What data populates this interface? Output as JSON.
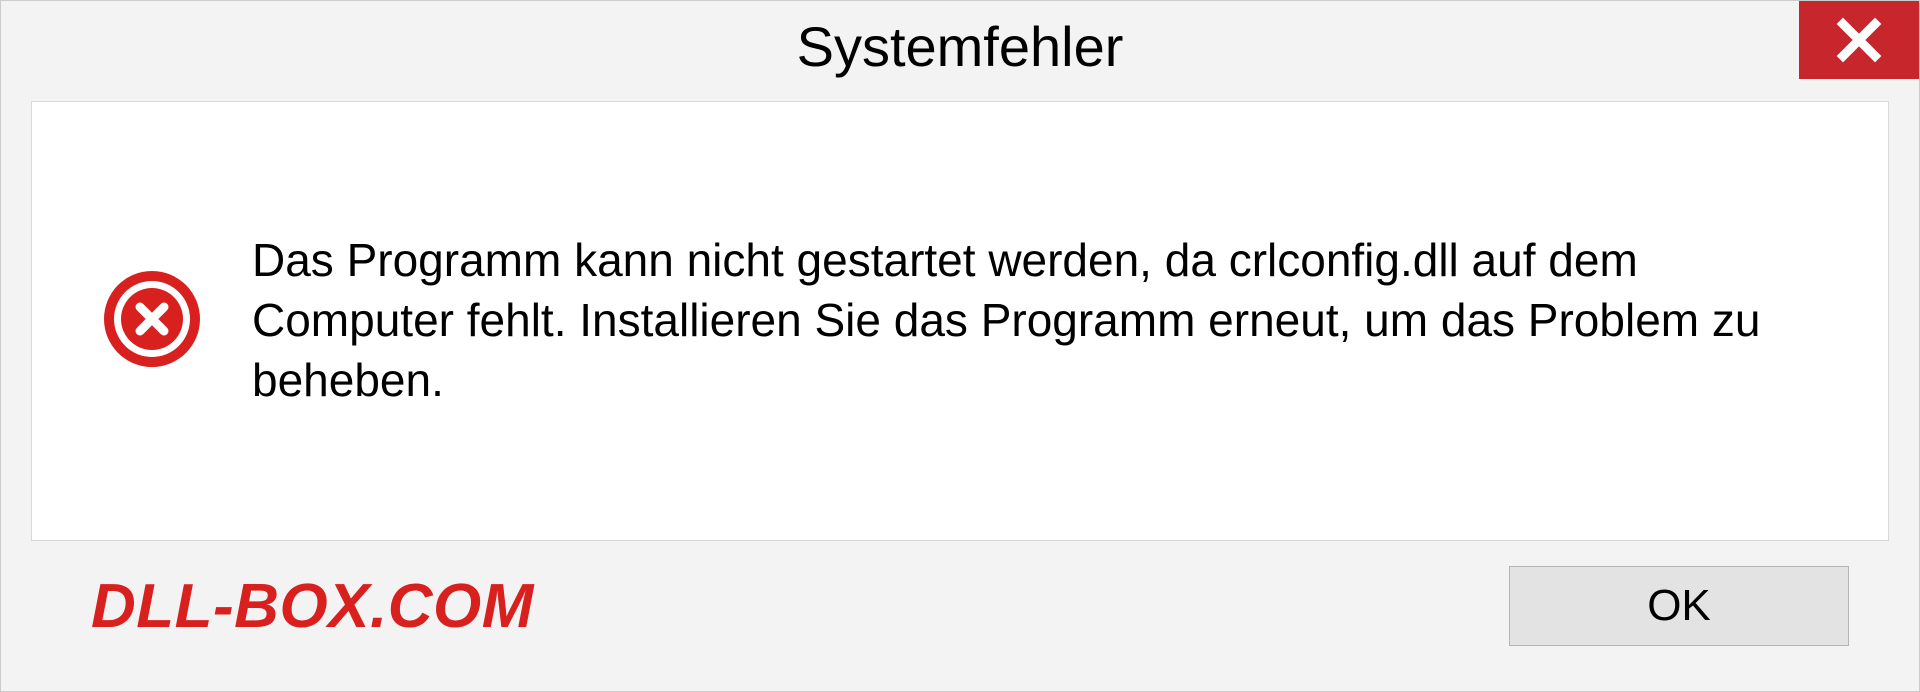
{
  "titlebar": {
    "title": "Systemfehler"
  },
  "message": {
    "text": "Das Programm kann nicht gestartet werden, da crlconfig.dll auf dem Computer fehlt. Installieren Sie das Programm erneut, um das Problem zu beheben."
  },
  "footer": {
    "watermark": "DLL-BOX.COM",
    "ok_label": "OK"
  },
  "colors": {
    "close_bg": "#c7262c",
    "error_icon": "#d8201f",
    "watermark": "#d8201f"
  }
}
